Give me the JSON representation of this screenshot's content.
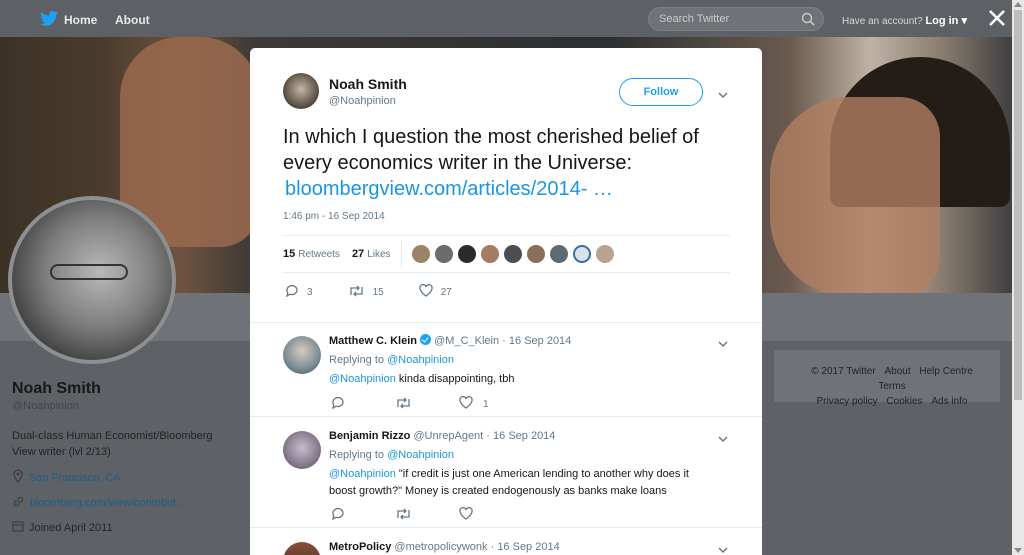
{
  "nav": {
    "home": "Home",
    "about": "About",
    "search_placeholder": "Search Twitter",
    "have_account": "Have an account?",
    "login": "Log in"
  },
  "profile": {
    "name": "Noah Smith",
    "handle": "@Noahpinion",
    "bio": "Dual-class Human Economist/Bloomberg View writer (lvl 2/13)",
    "location": "San Francisco, CA",
    "website": "bloomberg.com/view/contribut...",
    "joined": "Joined April 2011"
  },
  "footer": {
    "items": [
      "© 2017 Twitter",
      "About",
      "Help Centre",
      "Terms",
      "Privacy policy",
      "Cookies",
      "Ads info"
    ]
  },
  "tweet": {
    "name": "Noah Smith",
    "handle": "@Noahpinion",
    "follow": "Follow",
    "text": "In which I question the most cherished belief of every economics writer in the Universe:",
    "link": "bloombergview.com/articles/2014-  …",
    "time": "1:46 pm - 16 Sep 2014",
    "retweets_count": "15",
    "retweets_label": "Retweets",
    "likes_count": "27",
    "likes_label": "Likes",
    "reply_count": "3",
    "retweet_count": "15",
    "like_count": "27"
  },
  "replies": [
    {
      "name": "Matthew C. Klein",
      "handle": "@M_C_Klein",
      "date": "16 Sep 2014",
      "replying_label": "Replying to",
      "replying_to": "@Noahpinion",
      "mention": "@Noahpinion",
      "text": " kinda disappointing, tbh",
      "likes": "1"
    },
    {
      "name": "Benjamin Rizzo",
      "handle": "@UnrepAgent",
      "date": "16 Sep 2014",
      "replying_label": "Replying to",
      "replying_to": "@Noahpinion",
      "mention": "@Noahpinion",
      "text": "  \"if credit is just one American lending to another why does it boost growth?\" Money is created endogenously as banks make loans",
      "likes": ""
    },
    {
      "name": "MetroPolicy",
      "handle": "@metropolicywonk",
      "date": "16 Sep 2014"
    }
  ],
  "colors": {
    "accent": "#1da1f2",
    "link": "#1b95e0",
    "muted": "#657786"
  }
}
